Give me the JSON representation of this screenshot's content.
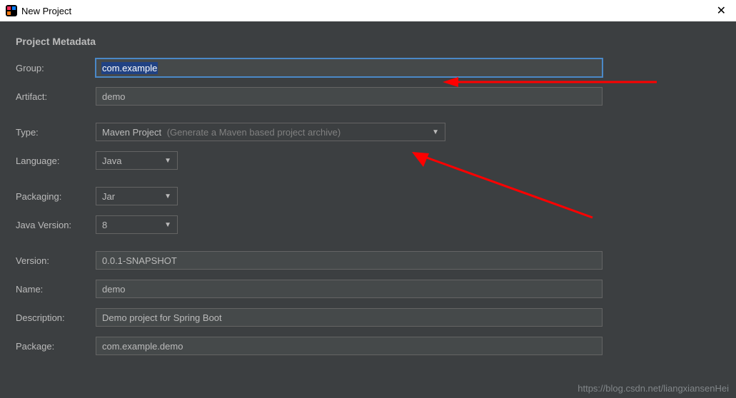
{
  "titlebar": {
    "title": "New Project"
  },
  "section": {
    "title": "Project Metadata"
  },
  "form": {
    "group": {
      "label": "Group:",
      "value": "com.example"
    },
    "artifact": {
      "label": "Artifact:",
      "value": "demo"
    },
    "type": {
      "label": "Type:",
      "value": "Maven Project",
      "hint": "(Generate a Maven based project archive)"
    },
    "language": {
      "label": "Language:",
      "value": "Java"
    },
    "packaging": {
      "label": "Packaging:",
      "value": "Jar"
    },
    "javaVersion": {
      "label": "Java Version:",
      "value": "8"
    },
    "version": {
      "label": "Version:",
      "value": "0.0.1-SNAPSHOT"
    },
    "name": {
      "label": "Name:",
      "value": "demo"
    },
    "description": {
      "label": "Description:",
      "value": "Demo project for Spring Boot"
    },
    "package": {
      "label": "Package:",
      "value": "com.example.demo"
    }
  },
  "watermark": "https://blog.csdn.net/liangxiansenHei"
}
